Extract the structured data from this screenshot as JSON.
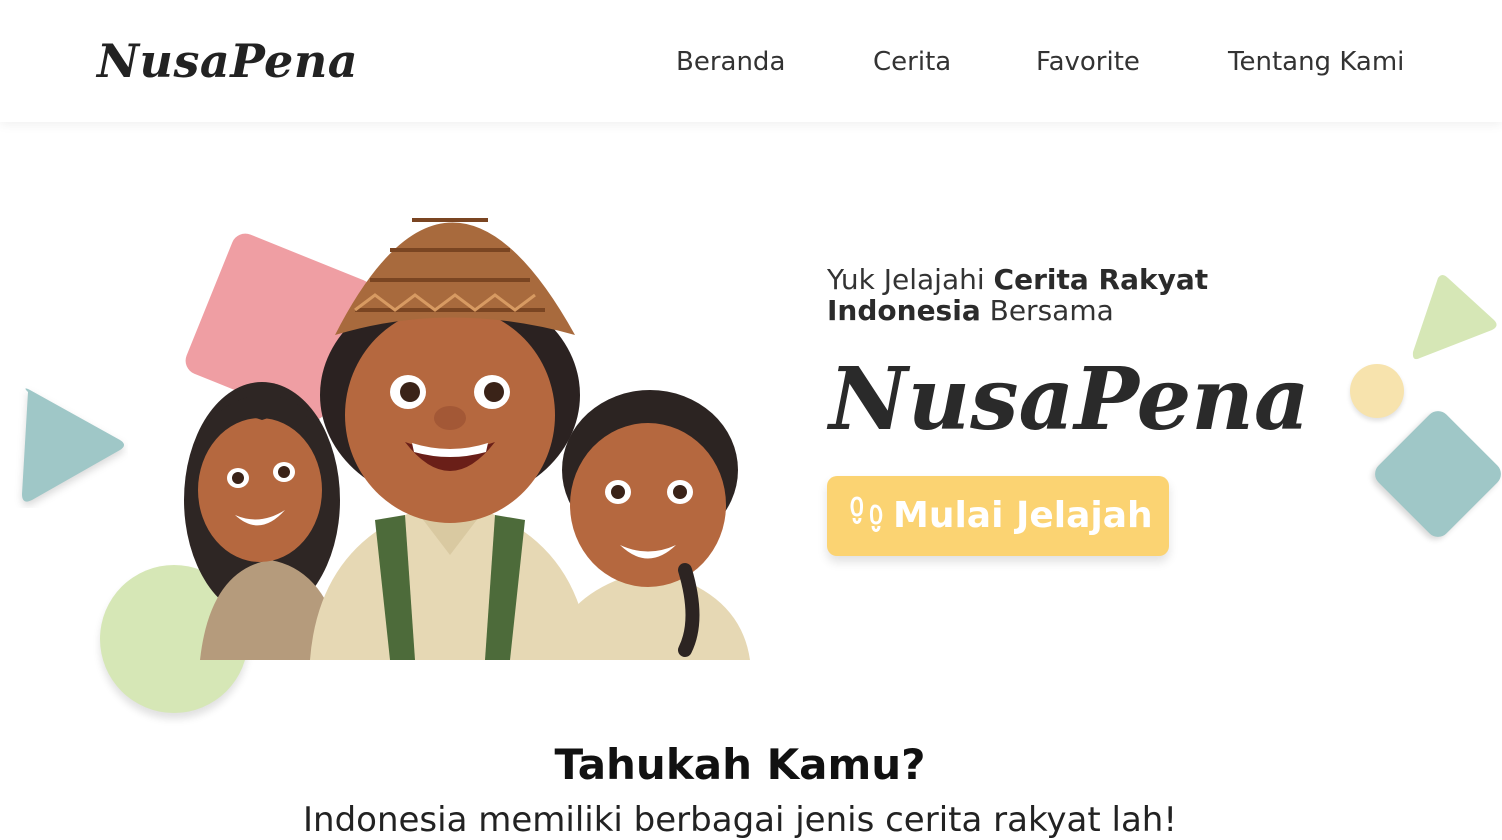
{
  "header": {
    "logo": "NusaPena",
    "nav": [
      "Beranda",
      "Cerita",
      "Favorite",
      "Tentang Kami"
    ]
  },
  "hero": {
    "intro_prefix": "Yuk Jelajahi ",
    "intro_bold": "Cerita Rakyat Indonesia",
    "intro_suffix": " Bersama",
    "brand": "NusaPena",
    "cta_label": "Mulai Jelajah",
    "cta_icon": "footprints-icon"
  },
  "section": {
    "title": "Tahukah Kamu?",
    "text": "Indonesia memiliki berbagai jenis cerita rakyat lah!"
  },
  "colors": {
    "accent": "#fbd372",
    "pink": "#ef9ea3",
    "teal": "#9fc7c7",
    "green": "#d6e7b6",
    "yellow": "#f7e3ad"
  }
}
